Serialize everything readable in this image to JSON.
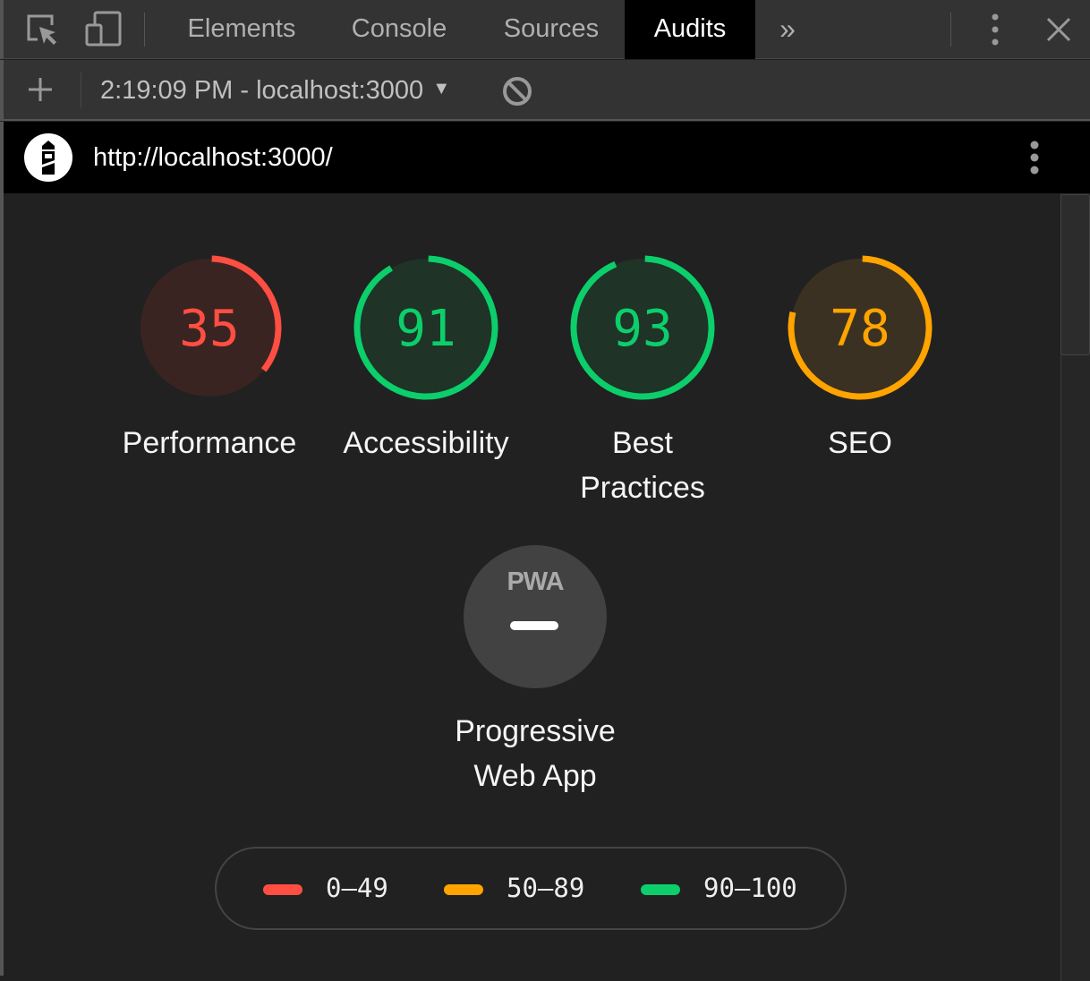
{
  "tabs": [
    {
      "label": "Elements"
    },
    {
      "label": "Console"
    },
    {
      "label": "Sources"
    },
    {
      "label": "Audits",
      "active": true
    }
  ],
  "toolbar": {
    "report_select": "2:19:09 PM - localhost:3000"
  },
  "header": {
    "url": "http://localhost:3000/"
  },
  "gauges": [
    {
      "label": "Performance",
      "score": 35,
      "color": "#ff4e42",
      "bg": "#3a2422"
    },
    {
      "label": "Accessibility",
      "score": 91,
      "color": "#0cce6b",
      "bg": "#1f3327"
    },
    {
      "label": "Best Practices",
      "score": 93,
      "color": "#0cce6b",
      "bg": "#1f3327"
    },
    {
      "label": "SEO",
      "score": 78,
      "color": "#ffa400",
      "bg": "#3a3122"
    }
  ],
  "pwa": {
    "logo": "PWA",
    "label": "Progressive Web App"
  },
  "legend": [
    {
      "range": "0–49",
      "color": "#ff4e42"
    },
    {
      "range": "50–89",
      "color": "#ffa400"
    },
    {
      "range": "90–100",
      "color": "#0cce6b"
    }
  ]
}
